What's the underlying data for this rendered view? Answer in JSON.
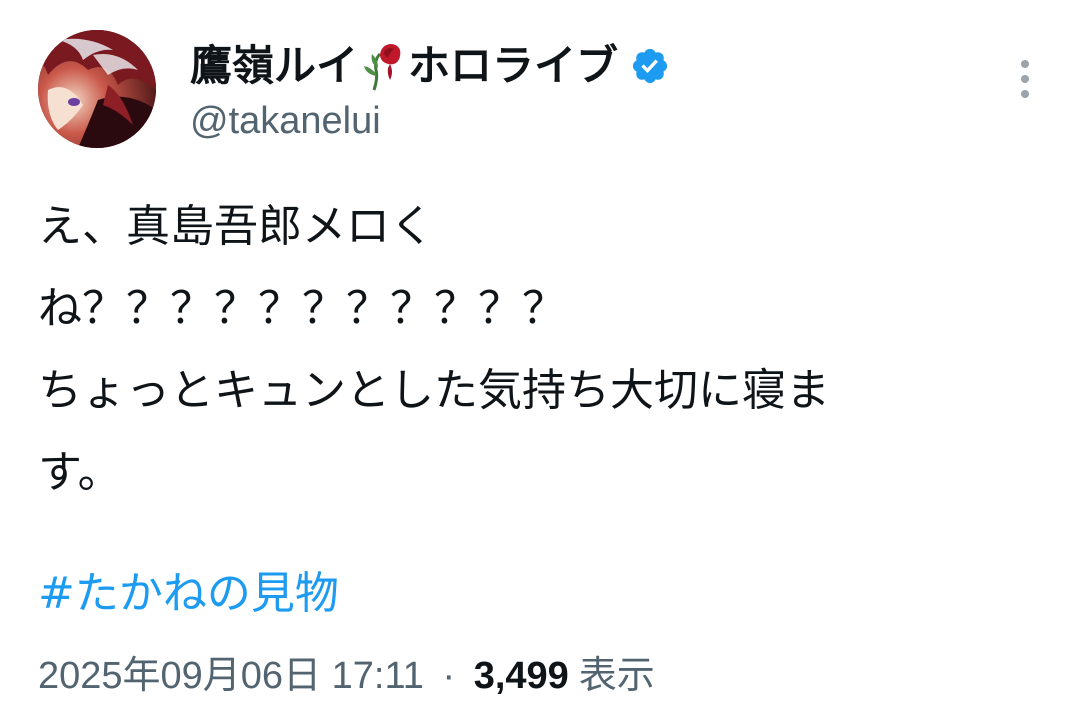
{
  "author": {
    "display_name_prefix": "鷹嶺ルイ",
    "display_name_suffix": "ホロライブ",
    "handle": "@takanelui",
    "name_emoji": "wilted-rose-icon",
    "verified_badge": "verified-check-icon"
  },
  "tweet": {
    "lines": [
      "え、真島吾郎メロく",
      "ね？？？？？？？？？？？",
      "ちょっとキュンとした気持ち大切に寝ま",
      "す。"
    ],
    "hashtag": "#たかねの見物"
  },
  "meta": {
    "date": "2025年09月06日",
    "time": "17:11",
    "separator": "·",
    "views_count": "3,499",
    "views_label": "表示"
  },
  "colors": {
    "link": "#1d9bf0",
    "secondary_text": "#536471",
    "primary_text": "#0f1419",
    "verified": "#1d9bf0"
  },
  "icons": {
    "more": "more-vertical-icon"
  }
}
